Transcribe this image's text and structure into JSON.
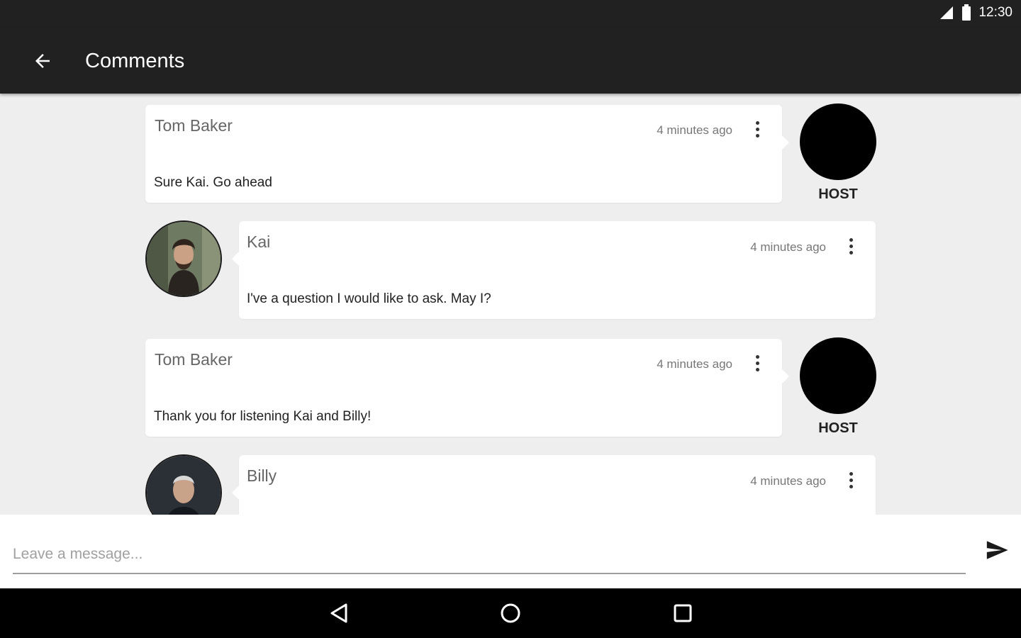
{
  "status_bar": {
    "time": "12:30",
    "signal_icon": "signal-icon",
    "battery_icon": "battery-icon"
  },
  "app_bar": {
    "title": "Comments",
    "back_icon": "arrow-back-icon"
  },
  "comments": [
    {
      "author": "Tom Baker",
      "time": "4 minutes ago",
      "text": "Sure Kai. Go ahead",
      "role": "host",
      "badge": "HOST"
    },
    {
      "author": "Kai",
      "time": "4 minutes ago",
      "text": "I've a question I would like to ask. May I?",
      "role": "user"
    },
    {
      "author": "Tom Baker",
      "time": "4 minutes ago",
      "text": "Thank you for listening Kai and Billy!",
      "role": "host",
      "badge": "HOST"
    },
    {
      "author": "Billy",
      "time": "4 minutes ago",
      "text": "",
      "role": "user"
    }
  ],
  "composer": {
    "placeholder": "Leave a message...",
    "value": "",
    "send_icon": "send-icon"
  },
  "nav_bar": {
    "back_icon": "nav-back-icon",
    "home_icon": "nav-home-icon",
    "recents_icon": "nav-recents-icon"
  },
  "colors": {
    "app_bar": "#212121",
    "background": "#eeeeee",
    "card": "#ffffff",
    "host_avatar": "#000000"
  }
}
